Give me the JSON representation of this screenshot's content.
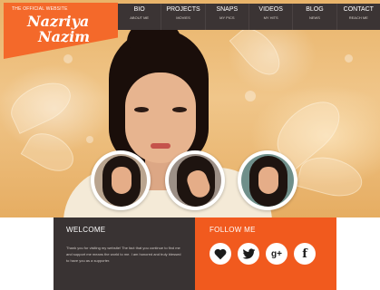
{
  "logo": {
    "tagline": "THE OFFICIAL WEBSITE",
    "first_name": "Nazriya",
    "last_name": "Nazim"
  },
  "nav": [
    {
      "label": "BIO",
      "sub": "ABOUT ME"
    },
    {
      "label": "PROJECTS",
      "sub": "MOVIES"
    },
    {
      "label": "SNAPS",
      "sub": "MY PICS"
    },
    {
      "label": "VIDEOS",
      "sub": "MY HITS"
    },
    {
      "label": "BLOG",
      "sub": "NEWS"
    },
    {
      "label": "CONTACT",
      "sub": "REACH ME"
    }
  ],
  "welcome": {
    "title": "WELCOME",
    "text": "Thank you for visiting my website! The fact that you continue to find me and support me means the world to me. I am honored and truly blessed to have you as a supporter."
  },
  "follow": {
    "title": "FOLLOW ME",
    "icons": [
      "heart-icon",
      "twitter-icon",
      "google-plus-icon",
      "facebook-icon"
    ],
    "google_plus_glyph": "g+",
    "facebook_glyph": "f"
  },
  "colors": {
    "accent_orange": "#f15a1e",
    "dark_panel": "#393333",
    "nav_bg": "#3b3434"
  }
}
